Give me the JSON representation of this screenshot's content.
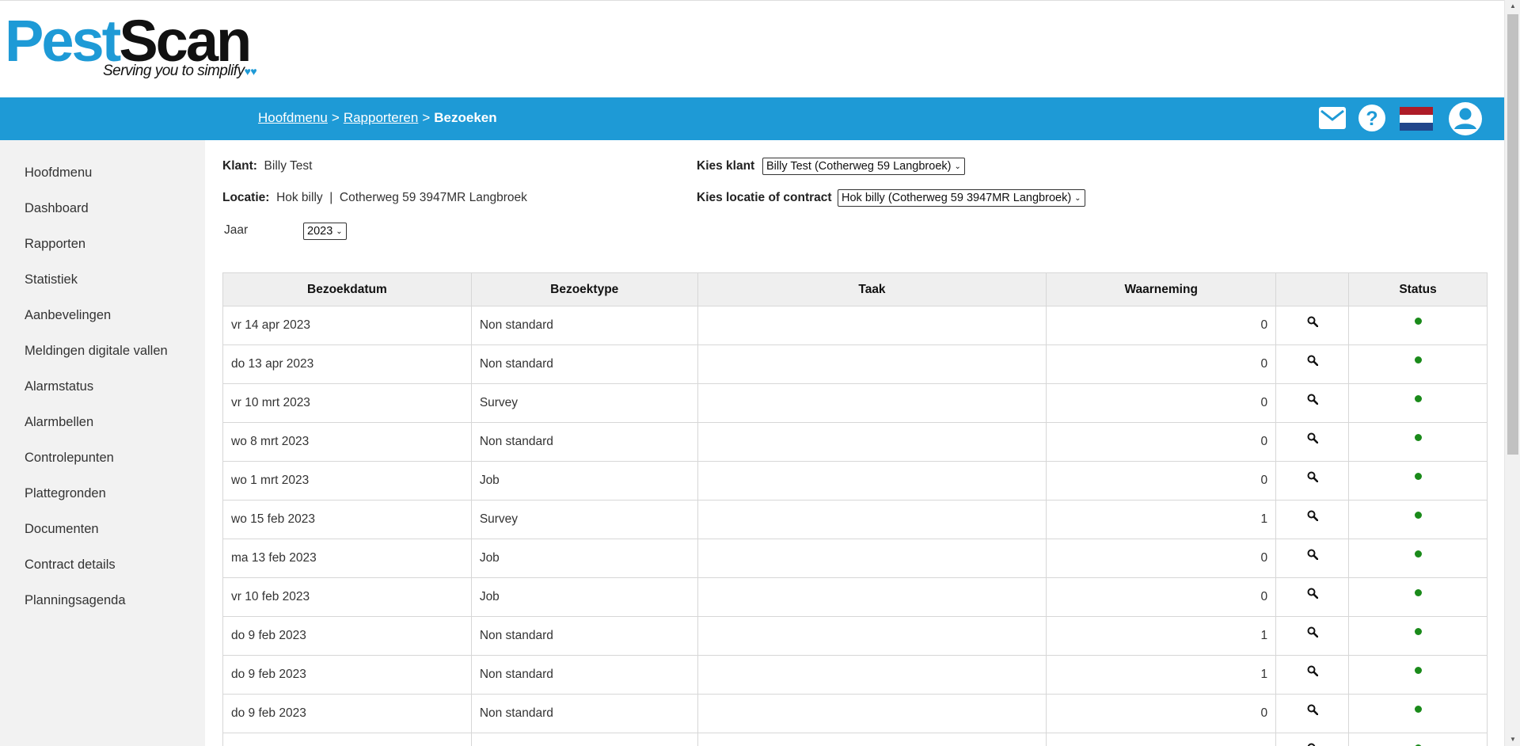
{
  "logo": {
    "pest": "Pest",
    "scan": "Scan",
    "tagline": "Serving you to simplify"
  },
  "breadcrumb": {
    "home": "Hoofdmenu",
    "reports": "Rapporteren",
    "current": "Bezoeken",
    "separator": ">"
  },
  "nav_icons": [
    "mail-icon",
    "help-icon",
    "flag-nl-icon",
    "user-avatar-icon"
  ],
  "sidebar": {
    "items": [
      "Hoofdmenu",
      "Dashboard",
      "Rapporten",
      "Statistiek",
      "Aanbevelingen",
      "Meldingen digitale vallen",
      "Alarmstatus",
      "Alarmbellen",
      "Controlepunten",
      "Plattegronden",
      "Documenten",
      "Contract details",
      "Planningsagenda"
    ]
  },
  "info": {
    "klant_label": "Klant:",
    "klant_value": "Billy Test",
    "locatie_label": "Locatie:",
    "locatie_value": "Hok billy",
    "locatie_divider": "|",
    "locatie_address": "Cotherweg 59 3947MR Langbroek",
    "kies_klant_label": "Kies klant",
    "kies_klant_value": "Billy Test (Cotherweg 59 Langbroek)",
    "kies_locatie_label": "Kies locatie of contract",
    "kies_locatie_value": "Hok billy (Cotherweg 59 3947MR Langbroek)",
    "jaar_label": "Jaar",
    "jaar_value": "2023"
  },
  "table": {
    "headers": [
      "Bezoekdatum",
      "Bezoektype",
      "Taak",
      "Waarneming",
      "",
      "Status"
    ],
    "rows": [
      {
        "date": "vr 14 apr 2023",
        "type": "Non standard",
        "task": "",
        "obs": "0"
      },
      {
        "date": "do 13 apr 2023",
        "type": "Non standard",
        "task": "",
        "obs": "0"
      },
      {
        "date": "vr 10 mrt 2023",
        "type": "Survey",
        "task": "",
        "obs": "0"
      },
      {
        "date": "wo 8 mrt 2023",
        "type": "Non standard",
        "task": "",
        "obs": "0"
      },
      {
        "date": "wo 1 mrt 2023",
        "type": "Job",
        "task": "",
        "obs": "0"
      },
      {
        "date": "wo 15 feb 2023",
        "type": "Survey",
        "task": "",
        "obs": "1"
      },
      {
        "date": "ma 13 feb 2023",
        "type": "Job",
        "task": "",
        "obs": "0"
      },
      {
        "date": "vr 10 feb 2023",
        "type": "Job",
        "task": "",
        "obs": "0"
      },
      {
        "date": "do 9 feb 2023",
        "type": "Non standard",
        "task": "",
        "obs": "1"
      },
      {
        "date": "do 9 feb 2023",
        "type": "Non standard",
        "task": "",
        "obs": "1"
      },
      {
        "date": "do 9 feb 2023",
        "type": "Non standard",
        "task": "",
        "obs": "0"
      },
      {
        "date": "",
        "type": "",
        "task": "",
        "obs": ""
      }
    ],
    "status_color": "#1a8a1a"
  },
  "colors": {
    "brand_blue": "#1e9ad6",
    "sidebar_bg": "#f2f2f2"
  }
}
